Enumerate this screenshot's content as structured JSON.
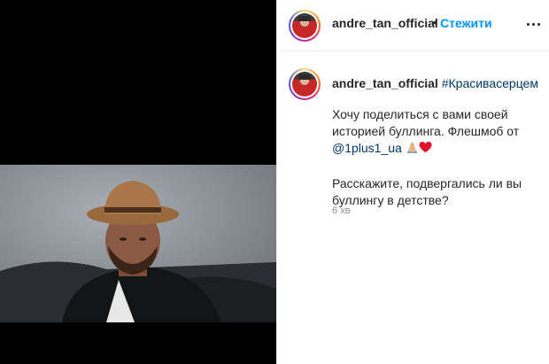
{
  "header": {
    "username": "andre_tan_official",
    "separator": "•",
    "follow_label": "Стежити",
    "more_icon": "more-horizontal-icon"
  },
  "caption": {
    "username": "andre_tan_official",
    "hashtag": "#Красивасерцем",
    "line1": "Хочу поделиться с вами своей",
    "line2": "историей буллинга. Флешмоб от",
    "mention": "@1plus1_ua",
    "emoji": [
      "praying-hands-icon",
      "red-heart-icon"
    ],
    "line4": "Расскажите, подвергались ли вы",
    "line5": "буллингу в детстве?",
    "time": "6 хв"
  },
  "colors": {
    "link": "#00376b",
    "follow": "#0095f6",
    "heart": "#ed4956"
  }
}
